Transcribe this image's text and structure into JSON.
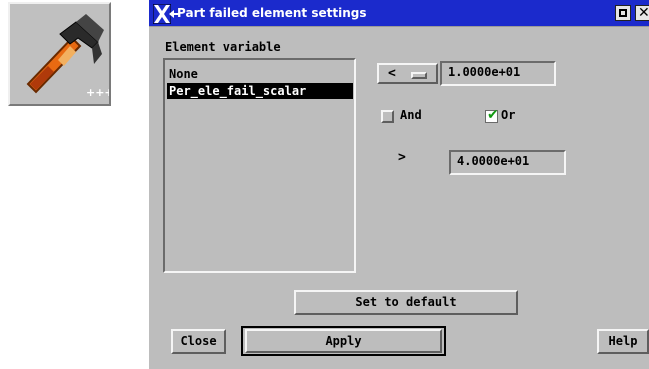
{
  "app_icon": {
    "name": "hammer-icon",
    "badge": "+++"
  },
  "window": {
    "title": "Part failed element settings"
  },
  "element_variable": {
    "label": "Element variable",
    "items": [
      "None",
      "Per_ele_fail_scalar"
    ],
    "selected_index": 1
  },
  "lower_bound": {
    "operator": "<",
    "value": "1.0000e+01"
  },
  "logic": {
    "and_label": "And",
    "or_label": "Or",
    "and_checked": false,
    "or_checked": true
  },
  "upper_bound": {
    "operator": ">",
    "value": "4.0000e+01"
  },
  "buttons": {
    "set_default": "Set to default",
    "close": "Close",
    "apply": "Apply",
    "help": "Help"
  },
  "colors": {
    "titlebar": "#1b2acc",
    "panel": "#bdbdbd",
    "check": "#119911"
  }
}
